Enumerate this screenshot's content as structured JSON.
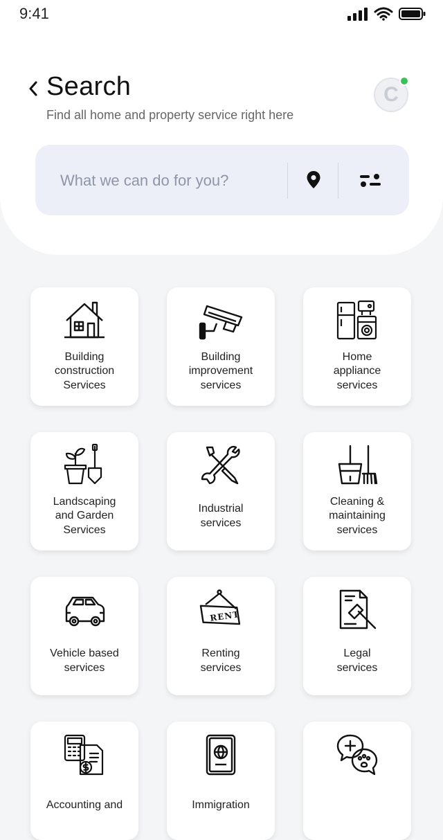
{
  "status_bar": {
    "time": "9:41"
  },
  "header": {
    "title": "Search",
    "subtitle": "Find all home and property service right here",
    "avatar_initial": "C"
  },
  "search": {
    "placeholder": "What we can do for you?",
    "value": ""
  },
  "colors": {
    "background": "#f4f5f7",
    "search_bg": "#eceff8",
    "online_dot": "#3cc05a",
    "icon_stroke": "#111111"
  },
  "categories": [
    {
      "label": "Building\nconstruction\nServices",
      "icon": "house-icon"
    },
    {
      "label": "Building\nimprovement\nservices",
      "icon": "security-camera-icon"
    },
    {
      "label": "Home\nappliance\nservices",
      "icon": "appliances-icon"
    },
    {
      "label": "Landscaping\nand Garden\nServices",
      "icon": "plant-pot-shovel-icon"
    },
    {
      "label": "Industrial\nservices",
      "icon": "wrench-screwdriver-icon"
    },
    {
      "label": "Cleaning &\nmaintaining\nservices",
      "icon": "bucket-mop-icon"
    },
    {
      "label": "Vehicle based\nservices",
      "icon": "car-icon"
    },
    {
      "label": "Renting\nservices",
      "icon": "rent-sign-icon",
      "sign_text": "RENT"
    },
    {
      "label": "Legal\nservices",
      "icon": "legal-document-gavel-icon"
    },
    {
      "label": "Accounting and\n",
      "icon": "calculator-invoice-icon"
    },
    {
      "label": "Immigration\n",
      "icon": "passport-icon"
    },
    {
      "label": "",
      "icon": "health-pet-chat-icon"
    }
  ]
}
